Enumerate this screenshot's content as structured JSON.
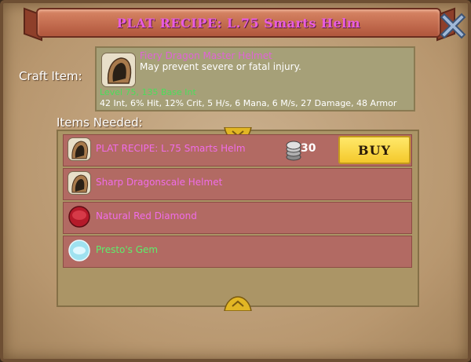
{
  "header": {
    "title": "PLAT RECIPE: L.75 Smarts Helm"
  },
  "craft": {
    "label": "Craft Item:",
    "item_name": "Fiery Dragon Master Helmet",
    "description": "May prevent severe or fatal injury.",
    "requirement": "Level 75, 135 Base Int",
    "stats": "42 Int, 6% Hit, 12% Crit, 5 H/s, 6 Mana, 6 M/s, 27 Damage, 48 Armor",
    "icon": "helmet-icon"
  },
  "items_needed": {
    "label": "Items Needed:",
    "rows": [
      {
        "name": "PLAT RECIPE: L.75 Smarts Helm",
        "color": "#f06ce8",
        "icon": "helmet-icon",
        "price": "30",
        "buy_label": "BUY"
      },
      {
        "name": "Sharp Dragonscale Helmet",
        "color": "#f06ce8",
        "icon": "helmet-icon"
      },
      {
        "name": "Natural Red Diamond",
        "color": "#f06ce8",
        "icon": "red-gem-icon"
      },
      {
        "name": "Presto's Gem",
        "color": "#5cf06c",
        "icon": "blue-gem-icon"
      }
    ]
  },
  "colors": {
    "epic_name": "#f06ce8",
    "rare_name": "#5cf06c",
    "buy_button": "#f4c92c"
  }
}
